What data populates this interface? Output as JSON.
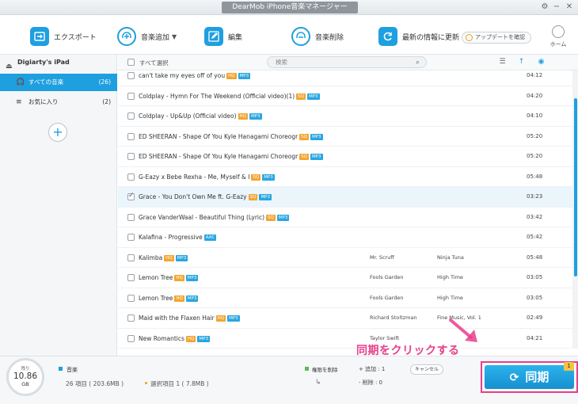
{
  "window": {
    "title": "DearMob iPhone音楽マネージャー",
    "settings_icon": "gear-icon",
    "minimize": "−",
    "close": "✕"
  },
  "toolbar": {
    "export": "エクスポート",
    "add_music": "音楽追加",
    "edit": "編集",
    "delete_music": "音楽削除",
    "refresh": "最新の情報に更新",
    "check_update": "アップデートを確認",
    "home": "ホーム"
  },
  "sidebar": {
    "device": "Digiarty's iPad",
    "items": [
      {
        "label": "すべての音楽",
        "count": "(26)"
      },
      {
        "label": "お気に入り",
        "count": "(2)"
      }
    ]
  },
  "list": {
    "select_all": "すべて選択",
    "search_placeholder": "検索",
    "rows": [
      {
        "title": "can't take my eyes off of you",
        "badges": [
          "HQ",
          "MP3"
        ],
        "artist": "",
        "album": "",
        "duration": "04:12",
        "checked": false
      },
      {
        "title": "Coldplay - Hymn For The Weekend (Official video)(1)",
        "badges": [
          "SQ",
          "MP3"
        ],
        "artist": "",
        "album": "",
        "duration": "04:20",
        "checked": false
      },
      {
        "title": "Coldplay - Up&Up (Official video)",
        "badges": [
          "HQ",
          "MP3"
        ],
        "artist": "",
        "album": "",
        "duration": "04:10",
        "checked": false
      },
      {
        "title": "ED SHEERAN - Shape Of You   Kyle Hanagami Choreogr",
        "badges": [
          "SQ",
          "MP3"
        ],
        "artist": "",
        "album": "",
        "duration": "05:20",
        "checked": false
      },
      {
        "title": "ED SHEERAN - Shape Of You   Kyle Hanagami Choreogr",
        "badges": [
          "SQ",
          "MP3"
        ],
        "artist": "",
        "album": "",
        "duration": "05:20",
        "checked": false
      },
      {
        "title": "G-Eazy x Bebe Rexha - Me, Myself & I",
        "badges": [
          "SQ",
          "MP3"
        ],
        "artist": "",
        "album": "",
        "duration": "05:48",
        "checked": false
      },
      {
        "title": "Grace - You Don't Own Me ft. G-Eazy",
        "badges": [
          "SQ",
          "MP3"
        ],
        "artist": "",
        "album": "",
        "duration": "03:23",
        "checked": true
      },
      {
        "title": "Grace VanderWaal - Beautiful Thing (Lyric)",
        "badges": [
          "SQ",
          "MP3"
        ],
        "artist": "",
        "album": "",
        "duration": "03:42",
        "checked": false
      },
      {
        "title": "Kalafina - Progressive",
        "badges": [
          "AAC"
        ],
        "artist": "",
        "album": "",
        "duration": "05:42",
        "checked": false
      },
      {
        "title": "Kalimba",
        "badges": [
          "HQ",
          "MP3"
        ],
        "artist": "Mr. Scruff",
        "album": "Ninja Tuna",
        "duration": "05:48",
        "checked": false
      },
      {
        "title": "Lemon Tree",
        "badges": [
          "HQ",
          "MP3"
        ],
        "artist": "Fools Garden",
        "album": "High Time",
        "duration": "03:05",
        "checked": false
      },
      {
        "title": "Lemon Tree",
        "badges": [
          "HQ",
          "MP3"
        ],
        "artist": "Fools Garden",
        "album": "High Time",
        "duration": "03:05",
        "checked": false
      },
      {
        "title": "Maid with the Flaxen Hair",
        "badges": [
          "HQ",
          "MP3"
        ],
        "artist": "Richard Stoltzman",
        "album": "Fine Music, Vol. 1",
        "duration": "02:49",
        "checked": false
      },
      {
        "title": "New Romantics",
        "badges": [
          "HQ",
          "MP3"
        ],
        "artist": "Taylor Swift",
        "album": "",
        "duration": "04:21",
        "checked": false
      }
    ]
  },
  "bottom": {
    "storage_label": "残り",
    "storage_value": "10.86",
    "storage_unit": "GB",
    "category": "音楽",
    "total_items": "26 項目 ( 203.6MB )",
    "selected_items": "選択項目 1 ( 7.8MB )",
    "permission_delete": "権限を削除",
    "add_count": "+ 追加 :  1",
    "delete_count": "- 削除 :  0",
    "cancel": "キャンセル",
    "sync": "同期",
    "sync_badge": "1"
  },
  "annotation": {
    "text": "同期をクリックする",
    "color": "#e83f8b"
  },
  "colors": {
    "accent": "#1e9fe0",
    "badge_orange": "#f3a531",
    "badge_blue": "#29a6e1",
    "annotation_pink": "#e83f8b"
  }
}
